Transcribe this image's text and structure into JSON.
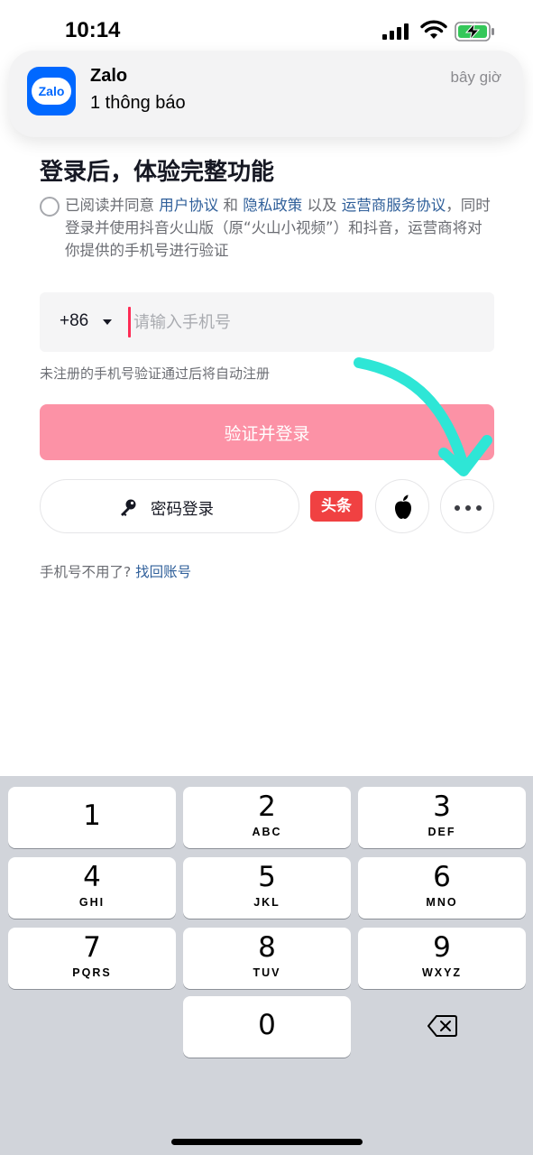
{
  "status_bar": {
    "time": "10:14"
  },
  "notification": {
    "app_name": "Zalo",
    "logo_text": "Zalo",
    "message": "1 thông báo",
    "time": "bây giờ"
  },
  "page": {
    "title": "登录后，体验完整功能",
    "agreement": {
      "prefix": "已阅读并同意 ",
      "user_agreement": "用户协议",
      "and": " 和 ",
      "privacy_policy": "隐私政策",
      "also": " 以及 ",
      "carrier_terms": "运营商服务协议",
      "suffix": "，同时登录并使用抖音火山版（原“火山小视频”）和抖音，运营商将对你提供的手机号进行验证"
    },
    "phone": {
      "country_code": "+86",
      "placeholder": "请输入手机号",
      "value": ""
    },
    "hint": "未注册的手机号验证通过后将自动注册",
    "login_button": "验证并登录",
    "password_login": "密码登录",
    "toutiao_label": "头条",
    "recover_prefix": "手机号不用了? ",
    "recover_link": "找回账号"
  },
  "keypad": {
    "keys": [
      {
        "digit": "1",
        "letters": ""
      },
      {
        "digit": "2",
        "letters": "ABC"
      },
      {
        "digit": "3",
        "letters": "DEF"
      },
      {
        "digit": "4",
        "letters": "GHI"
      },
      {
        "digit": "5",
        "letters": "JKL"
      },
      {
        "digit": "6",
        "letters": "MNO"
      },
      {
        "digit": "7",
        "letters": "PQRS"
      },
      {
        "digit": "8",
        "letters": "TUV"
      },
      {
        "digit": "9",
        "letters": "WXYZ"
      },
      {
        "digit": "0",
        "letters": ""
      }
    ]
  },
  "colors": {
    "accent": "#fe2c55",
    "login_button_disabled": "#fc92a6",
    "link": "#2f5f9a",
    "zalo_blue": "#0068ff",
    "annotation": "#2ee6d6"
  },
  "icons": [
    "signal-icon",
    "wifi-icon",
    "battery-charging-icon",
    "key-icon",
    "apple-icon",
    "more-icon",
    "delete-icon"
  ]
}
